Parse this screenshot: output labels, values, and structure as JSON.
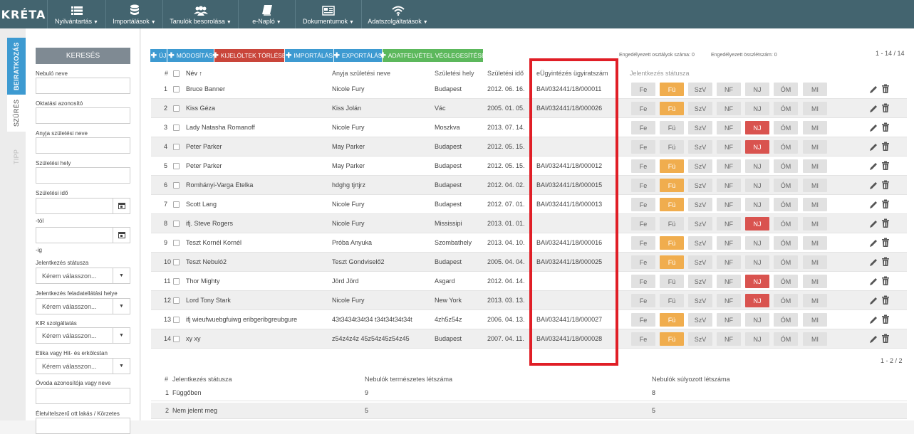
{
  "app": {
    "logo": "KRÉTA"
  },
  "menu": [
    {
      "label": "Nyilvántartás",
      "icon": "list-icon"
    },
    {
      "label": "Importálások",
      "icon": "database-icon"
    },
    {
      "label": "Tanulók besorolása",
      "icon": "users-icon"
    },
    {
      "label": "e-Napló",
      "icon": "book-icon"
    },
    {
      "label": "Dokumentumok",
      "icon": "newspaper-icon"
    },
    {
      "label": "Adatszolgáltatások",
      "icon": "wifi-icon"
    }
  ],
  "side_tabs": {
    "enrollment": "BEIRATKOZÁS",
    "filter": "SZŰRÉS",
    "tip": "TIPP"
  },
  "filter": {
    "search_button": "KERESÉS",
    "fields": {
      "name": "Nebuló neve",
      "edu_id": "Oktatási azonosító",
      "mother_birth_name": "Anyja születési neve",
      "birth_place": "Születési hely",
      "birth_date": "Születési idő",
      "from": "-tól",
      "to": "-ig",
      "status": "Jelentkezés státusza",
      "task_place": "Jelentkezés feladatellátási helye",
      "kir": "KIR szolgáltatás",
      "ethics": "Etika vagy Hit- és erkölcstan",
      "kindergarten": "Óvoda azonosítója vagy neve",
      "residence": "Életvitelszerű ott lakás / Körzetes"
    },
    "select_placeholder": "Kérem válasszon..."
  },
  "toolbar": {
    "new": "ÚJ",
    "modify": "MÓDOSÍTÁS",
    "delete_selected": "KIJELÖLTEK TÖRLÉSE",
    "import": "IMPORTÁLÁS",
    "export": "EXPORTÁLÁS",
    "finalize": "ADATFELVÉTEL VÉGLEGESÍTÉSE"
  },
  "stats": {
    "allowed_classes": "Engedélyezett osztályok száma: 0",
    "allowed_total": "Engedélyezett összlétszám: 0"
  },
  "pager_top": "1 - 14 / 14",
  "pager_bottom": "1 - 2 / 2",
  "columns": {
    "num": "#",
    "name": "Név ↑",
    "mother": "Anyja születési neve",
    "place": "Születési hely",
    "date": "Születési idő",
    "case": "eÜgyintézés ügyiratszám",
    "status": "Jelentkezés státusza"
  },
  "status_labels": [
    "Fe",
    "Fü",
    "SzV",
    "NF",
    "NJ",
    "ÓM",
    "MI"
  ],
  "colors": {
    "orange": "#f0ad4e",
    "red": "#d9534f",
    "highlight": "#e01e26"
  },
  "rows": [
    {
      "num": "1",
      "name": "Bruce Banner",
      "mother": "Nicole Fury",
      "place": "Budapest",
      "date": "2012. 06. 16.",
      "case": "BAI/032441/18/000011",
      "active": "Fü"
    },
    {
      "num": "2",
      "name": "Kiss Géza",
      "mother": "Kiss Jolán",
      "place": "Vác",
      "date": "2005. 01. 05.",
      "case": "BAI/032441/18/000026",
      "active": "Fü"
    },
    {
      "num": "3",
      "name": "Lady Natasha Romanoff",
      "mother": "Nicole Fury",
      "place": "Moszkva",
      "date": "2013. 07. 14.",
      "case": "",
      "active": "NJ"
    },
    {
      "num": "4",
      "name": "Peter Parker",
      "mother": "May Parker",
      "place": "Budapest",
      "date": "2012. 05. 15.",
      "case": "",
      "active": "NJ"
    },
    {
      "num": "5",
      "name": "Peter Parker",
      "mother": "May Parker",
      "place": "Budapest",
      "date": "2012. 05. 15.",
      "case": "BAI/032441/18/000012",
      "active": "Fü"
    },
    {
      "num": "6",
      "name": "Romhányi-Varga Etelka",
      "mother": "hdghg tjrtjrz",
      "place": "Budapest",
      "date": "2012. 04. 02.",
      "case": "BAI/032441/18/000015",
      "active": "Fü"
    },
    {
      "num": "7",
      "name": "Scott Lang",
      "mother": "Nicole Fury",
      "place": "Budapest",
      "date": "2012. 07. 01.",
      "case": "BAI/032441/18/000013",
      "active": "Fü"
    },
    {
      "num": "8",
      "name": "ifj. Steve Rogers",
      "mother": "Nicole Fury",
      "place": "Mississipi",
      "date": "2013. 01. 01.",
      "case": "",
      "active": "NJ"
    },
    {
      "num": "9",
      "name": "Teszt Kornél Kornél",
      "mother": "Próba Anyuka",
      "place": "Szombathely",
      "date": "2013. 04. 10.",
      "case": "BAI/032441/18/000016",
      "active": "Fü"
    },
    {
      "num": "10",
      "name": "Teszt Nebuló2",
      "mother": "Teszt Gondviselő2",
      "place": "Budapest",
      "date": "2005. 04. 04.",
      "case": "BAI/032441/18/000025",
      "active": "Fü"
    },
    {
      "num": "11",
      "name": "Thor Mighty",
      "mother": "Jörd Jörd",
      "place": "Asgard",
      "date": "2012. 04. 14.",
      "case": "",
      "active": "NJ"
    },
    {
      "num": "12",
      "name": "Lord Tony Stark",
      "mother": "Nicole Fury",
      "place": "New York",
      "date": "2013. 03. 13.",
      "case": "",
      "active": "NJ"
    },
    {
      "num": "13",
      "name": "ifj wieufwuebgfuiwg eribgeribgreubgure",
      "mother": "43t3434t34t34 t34t34t34t34t",
      "place": "4zh5z54z",
      "date": "2006. 04. 13.",
      "case": "BAI/032441/18/000027",
      "active": "Fü"
    },
    {
      "num": "14",
      "name": "xy xy",
      "mother": "z54z4z4z 45z54z45z54z45",
      "place": "Budapest",
      "date": "2007. 04. 11.",
      "case": "BAI/032441/18/000028",
      "active": "Fü"
    }
  ],
  "summary": {
    "columns": {
      "num": "#",
      "status": "Jelentkezés státusza",
      "natural": "Nebulók természetes létszáma",
      "weighted": "Nebulók súlyozott létszáma"
    },
    "rows": [
      {
        "num": "1",
        "status": "Függőben",
        "natural": "9",
        "weighted": "8"
      },
      {
        "num": "2",
        "status": "Nem jelent meg",
        "natural": "5",
        "weighted": "5"
      }
    ]
  }
}
